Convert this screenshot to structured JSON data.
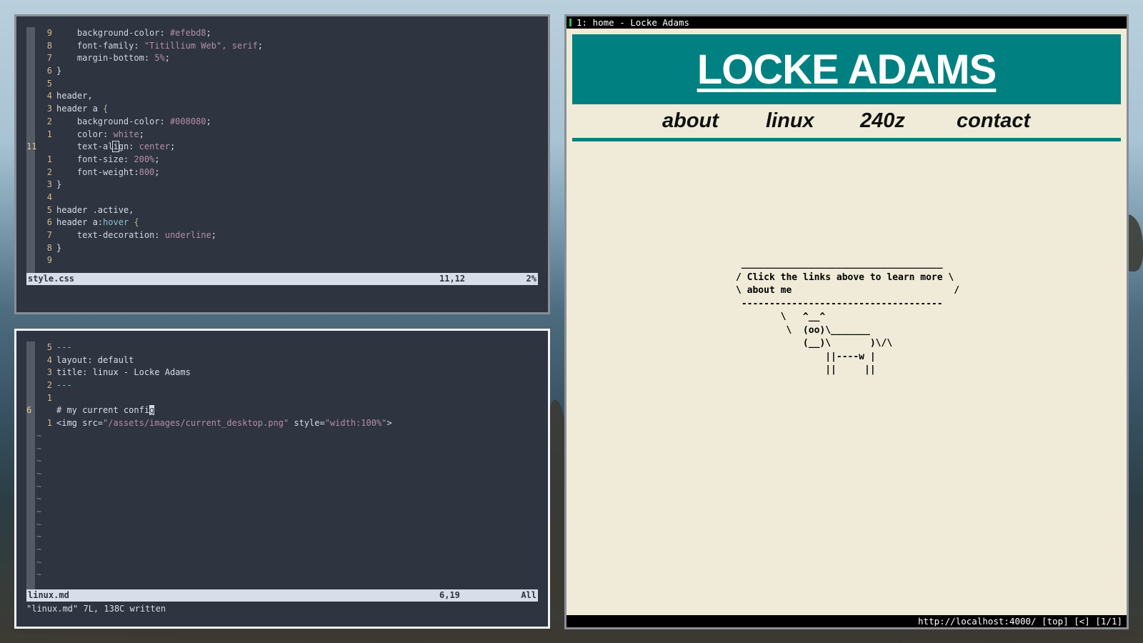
{
  "colors": {
    "editor_bg": "#2e3440",
    "gutter": "#545b66",
    "line_number": "#d7b98a",
    "statusline_bg": "#d8dee9",
    "site_bg": "#efebd8",
    "site_header": "#008080"
  },
  "css_editor": {
    "lines": [
      {
        "num": "9",
        "tokens": [
          {
            "c": "k",
            "t": "    background-color"
          },
          {
            "c": "t",
            "t": ": "
          },
          {
            "c": "v",
            "t": "#efebd8"
          },
          {
            "c": "t",
            "t": ";"
          }
        ]
      },
      {
        "num": "8",
        "tokens": [
          {
            "c": "k",
            "t": "    font-family"
          },
          {
            "c": "t",
            "t": ": "
          },
          {
            "c": "v",
            "t": "\"Titillium Web\", serif"
          },
          {
            "c": "t",
            "t": ";"
          }
        ]
      },
      {
        "num": "7",
        "tokens": [
          {
            "c": "k",
            "t": "    margin-bottom"
          },
          {
            "c": "t",
            "t": ": "
          },
          {
            "c": "v",
            "t": "5%"
          },
          {
            "c": "t",
            "t": ";"
          }
        ]
      },
      {
        "num": "6",
        "tokens": [
          {
            "c": "t",
            "t": "}"
          }
        ]
      },
      {
        "num": "5",
        "tokens": []
      },
      {
        "num": "4",
        "tokens": [
          {
            "c": "t",
            "t": "header,"
          }
        ]
      },
      {
        "num": "3",
        "tokens": [
          {
            "c": "t",
            "t": "header a "
          },
          {
            "c": "s",
            "t": "{"
          }
        ]
      },
      {
        "num": "2",
        "tokens": [
          {
            "c": "k",
            "t": "    background-color"
          },
          {
            "c": "t",
            "t": ": "
          },
          {
            "c": "v",
            "t": "#008080"
          },
          {
            "c": "t",
            "t": ";"
          }
        ]
      },
      {
        "num": "1",
        "tokens": [
          {
            "c": "k",
            "t": "    color"
          },
          {
            "c": "t",
            "t": ": "
          },
          {
            "c": "v",
            "t": "white"
          },
          {
            "c": "t",
            "t": ";"
          }
        ]
      },
      {
        "num": "11",
        "current": true,
        "tokens": [
          {
            "c": "k",
            "t": "    text-al"
          },
          {
            "c": "cursor",
            "t": "i"
          },
          {
            "c": "k",
            "t": "gn"
          },
          {
            "c": "t",
            "t": ": "
          },
          {
            "c": "v",
            "t": "center"
          },
          {
            "c": "t",
            "t": ";"
          }
        ]
      },
      {
        "num": "1",
        "tokens": [
          {
            "c": "k",
            "t": "    font-size"
          },
          {
            "c": "t",
            "t": ": "
          },
          {
            "c": "v",
            "t": "200%"
          },
          {
            "c": "t",
            "t": ";"
          }
        ]
      },
      {
        "num": "2",
        "tokens": [
          {
            "c": "k",
            "t": "    font-weight"
          },
          {
            "c": "t",
            "t": ":"
          },
          {
            "c": "v",
            "t": "800"
          },
          {
            "c": "t",
            "t": ";"
          }
        ]
      },
      {
        "num": "3",
        "tokens": [
          {
            "c": "t",
            "t": "}"
          }
        ]
      },
      {
        "num": "4",
        "tokens": []
      },
      {
        "num": "5",
        "tokens": [
          {
            "c": "t",
            "t": "header .active,"
          }
        ]
      },
      {
        "num": "6",
        "tokens": [
          {
            "c": "t",
            "t": "header a:"
          },
          {
            "c": "p",
            "t": "hover"
          },
          {
            "c": "t",
            "t": " "
          },
          {
            "c": "s",
            "t": "{"
          }
        ]
      },
      {
        "num": "7",
        "tokens": [
          {
            "c": "k",
            "t": "    text-decoration"
          },
          {
            "c": "t",
            "t": ": "
          },
          {
            "c": "v",
            "t": "underline"
          },
          {
            "c": "t",
            "t": ";"
          }
        ]
      },
      {
        "num": "8",
        "tokens": [
          {
            "c": "t",
            "t": "}"
          }
        ]
      },
      {
        "num": "9",
        "tokens": []
      }
    ],
    "status": {
      "filename": "style.css",
      "position": "11,12",
      "percent": "2%"
    }
  },
  "md_editor": {
    "lines": [
      {
        "num": "5",
        "tokens": [
          {
            "c": "p",
            "t": "---"
          }
        ]
      },
      {
        "num": "4",
        "tokens": [
          {
            "c": "t",
            "t": "layout: default"
          }
        ]
      },
      {
        "num": "3",
        "tokens": [
          {
            "c": "t",
            "t": "title: linux - Locke Adams"
          }
        ]
      },
      {
        "num": "2",
        "tokens": [
          {
            "c": "p",
            "t": "---"
          }
        ]
      },
      {
        "num": "1",
        "tokens": []
      },
      {
        "num": "6",
        "current": true,
        "tokens": [
          {
            "c": "t",
            "t": "# my current confi"
          },
          {
            "c": "block",
            "t": "g"
          }
        ]
      },
      {
        "num": "1",
        "tokens": [
          {
            "c": "t",
            "t": "<img src="
          },
          {
            "c": "v",
            "t": "\"/assets/images/current_desktop.png\""
          },
          {
            "c": "t",
            "t": " style="
          },
          {
            "c": "v",
            "t": "\"width:100%\""
          },
          {
            "c": "t",
            "t": ">"
          }
        ]
      }
    ],
    "tildes": [
      "~",
      "~",
      "~",
      "~",
      "~",
      "~",
      "~",
      "~",
      "~",
      "~",
      "~",
      "~"
    ],
    "status": {
      "filename": "linux.md",
      "position": "6,19",
      "percent": "All"
    },
    "message": "\"linux.md\" 7L, 138C written"
  },
  "browser": {
    "tab_title": "1: home - Locke Adams",
    "site_title": "LOCKE ADAMS",
    "nav": [
      "about",
      "linux",
      "240z",
      "contact"
    ],
    "cowsay": " ____________________________________\n/ Click the links above to learn more \\\n\\ about me                             /\n ------------------------------------\n        \\   ^__^\n         \\  (oo)\\_______\n            (__)\\       )\\/\\\n                ||----w |\n                ||     ||",
    "status_url": "http://localhost:4000/ [top] [<] [1/1]"
  }
}
